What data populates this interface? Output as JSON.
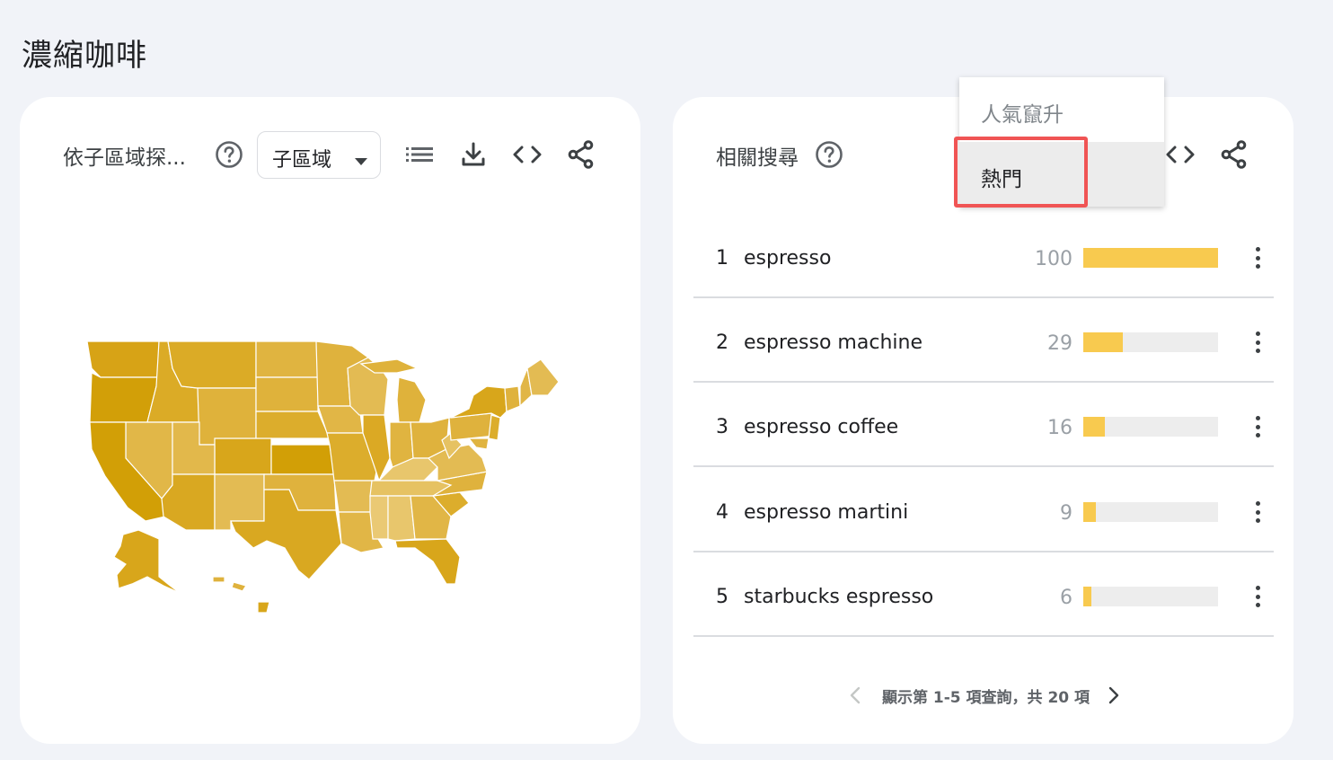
{
  "page": {
    "title": "濃縮咖啡"
  },
  "region_card": {
    "title": "依子區域探...",
    "resolution_select": "子區域",
    "icons": [
      "help-icon",
      "list-icon",
      "download-icon",
      "embed-icon",
      "share-icon"
    ],
    "map_color": "#d4a20c"
  },
  "related_card": {
    "title": "相關搜尋",
    "dropdown": {
      "options": [
        "人氣竄升",
        "熱門"
      ],
      "highlighted": "熱門"
    },
    "rows": [
      {
        "rank": "1",
        "term": "espresso",
        "value": "100",
        "fill_percent": 100
      },
      {
        "rank": "2",
        "term": "espresso machine",
        "value": "29",
        "fill_percent": 29
      },
      {
        "rank": "3",
        "term": "espresso coffee",
        "value": "16",
        "fill_percent": 16
      },
      {
        "rank": "4",
        "term": "espresso martini",
        "value": "9",
        "fill_percent": 9
      },
      {
        "rank": "5",
        "term": "starbucks espresso",
        "value": "6",
        "fill_percent": 6
      }
    ],
    "pagination": "顯示第 1-5 項查詢，共 20 項"
  },
  "colors": {
    "bar": "#f8ca4f",
    "track": "#ededed",
    "highlight": "#f05454"
  }
}
